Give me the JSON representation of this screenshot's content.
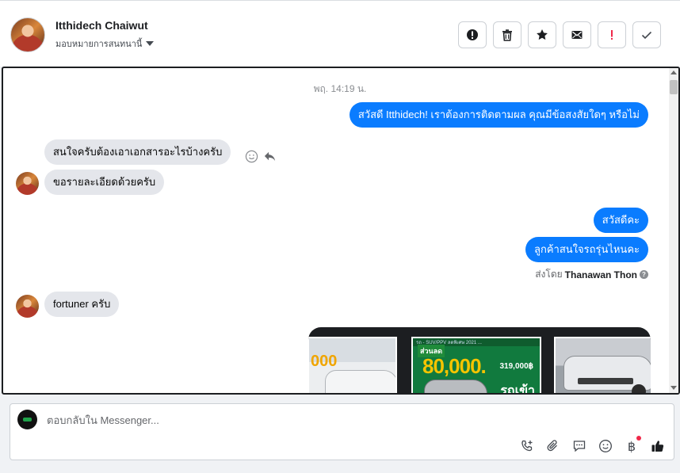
{
  "header": {
    "contact_name": "Itthidech Chaiwut",
    "assign_label": "มอบหมายการสนทนานี้",
    "toolbar": [
      {
        "name": "spam-button",
        "icon": "alert-circle-icon"
      },
      {
        "name": "delete-button",
        "icon": "trash-icon"
      },
      {
        "name": "star-button",
        "icon": "star-icon"
      },
      {
        "name": "mark-unread-button",
        "icon": "envelope-icon"
      },
      {
        "name": "follow-up-button",
        "icon": "exclamation-icon"
      },
      {
        "name": "mark-done-button",
        "icon": "check-icon"
      }
    ]
  },
  "chat": {
    "timestamp": "พฤ. 14:19 น.",
    "messages": [
      {
        "direction": "out",
        "text": "สวัสดี Itthidech! เราต้องการติดตามผล คุณมีข้อสงสัยใดๆ หรือไม่"
      },
      {
        "direction": "in",
        "text": "สนใจครับต้องเอาเอกสารอะไรบ้างครับ"
      },
      {
        "direction": "in",
        "text": "ขอรายละเอียดด้วยครับ"
      },
      {
        "direction": "out",
        "text": "สวัสดีคะ"
      },
      {
        "direction": "out",
        "text": "ลูกค้าสนใจรถรุ่นไหนคะ"
      },
      {
        "direction": "in",
        "text": "fortuner ครับ"
      }
    ],
    "sent_by_prefix": "ส่งโดย",
    "sent_by_name": "Thanawan Thon",
    "carousel": {
      "cards": [
        {
          "name": "product-card-pajero",
          "headline": "000"
        },
        {
          "name": "product-card-promo",
          "strip": "รถ - SUV/PPV ลดพิเศษ 2021 ...",
          "badge": "ส่วนลด",
          "headline": "80,000.",
          "price": "319,000฿",
          "tag": "รถเข้า"
        },
        {
          "name": "product-card-fortuner",
          "headline": ""
        }
      ]
    }
  },
  "composer": {
    "placeholder": "ตอบกลับใน Messenger...",
    "icons": [
      "call-add-icon",
      "attachment-icon",
      "saved-replies-icon",
      "emoji-icon",
      "payment-icon",
      "thumbs-up-icon"
    ]
  },
  "colors": {
    "outgoing_bubble": "#0a7cff",
    "incoming_bubble": "#e4e6eb",
    "follow_up_red": "#f02849"
  }
}
